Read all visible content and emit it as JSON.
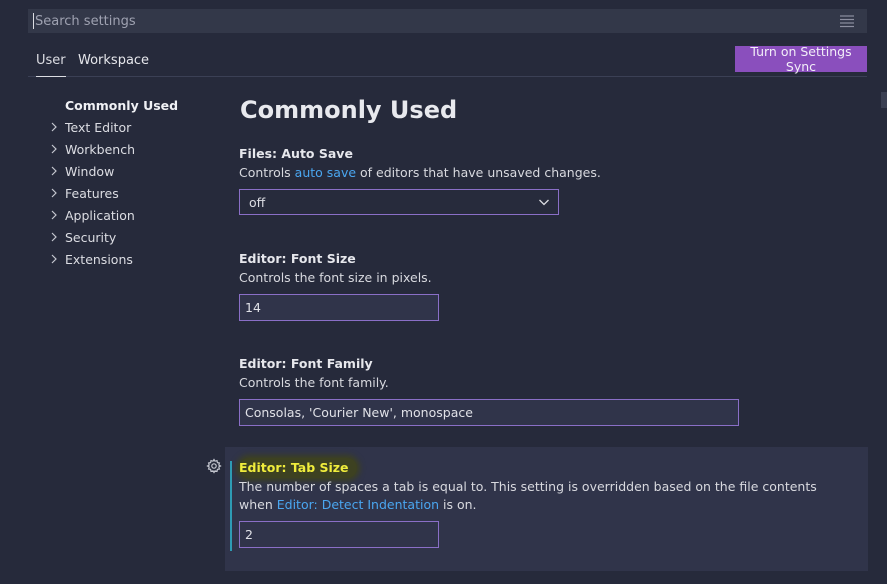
{
  "search": {
    "placeholder": "Search settings"
  },
  "tabs": [
    {
      "label": "User"
    },
    {
      "label": "Workspace"
    }
  ],
  "sync_button": {
    "label": "Turn on Settings Sync"
  },
  "toc": {
    "selected": "Commonly Used",
    "items": [
      {
        "label": "Text Editor"
      },
      {
        "label": "Workbench"
      },
      {
        "label": "Window"
      },
      {
        "label": "Features"
      },
      {
        "label": "Application"
      },
      {
        "label": "Security"
      },
      {
        "label": "Extensions"
      }
    ]
  },
  "main": {
    "title": "Commonly Used",
    "settings": {
      "auto_save": {
        "title": "Files: Auto Save",
        "desc_prefix": "Controls ",
        "desc_link": "auto save",
        "desc_suffix": " of editors that have unsaved changes.",
        "value": "off"
      },
      "font_size": {
        "title": "Editor: Font Size",
        "desc": "Controls the font size in pixels.",
        "value": "14"
      },
      "font_family": {
        "title": "Editor: Font Family",
        "desc": "Controls the font family.",
        "value": "Consolas, 'Courier New', monospace"
      },
      "tab_size": {
        "title": "Editor: Tab Size",
        "desc_prefix": "The number of spaces a tab is equal to. This setting is overridden based on the file contents when ",
        "desc_link": "Editor: Detect Indentation",
        "desc_suffix": " is on.",
        "value": "2"
      }
    }
  },
  "colors": {
    "background": "#262a3b",
    "accent_purple": "#8a4fbd",
    "link": "#4aa6f0",
    "highlight_text": "#f0ec3c",
    "focus_bar": "#2e9bb4"
  }
}
